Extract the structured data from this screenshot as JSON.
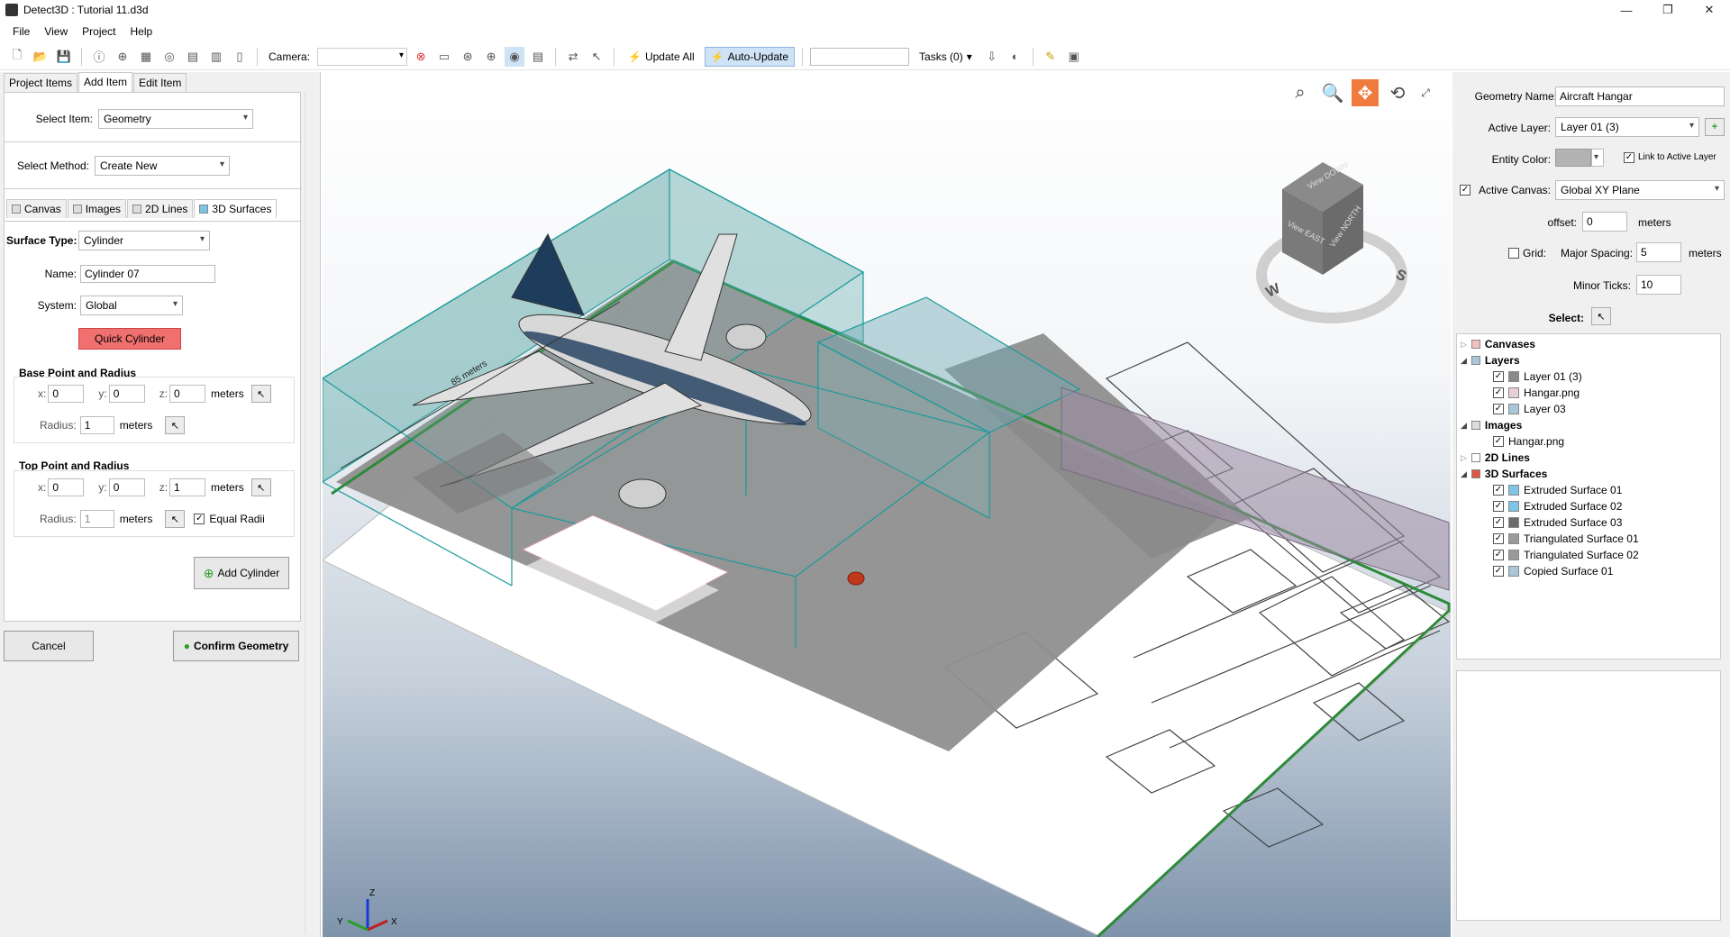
{
  "window": {
    "title": "Detect3D : Tutorial 11.d3d",
    "min": "—",
    "max": "❐",
    "close": "✕"
  },
  "menu": [
    "File",
    "View",
    "Project",
    "Help"
  ],
  "toolbar": {
    "camera_label": "Camera:",
    "update_all": "Update All",
    "auto_update": "Auto-Update",
    "tasks": "Tasks (0)"
  },
  "left": {
    "tabs": [
      "Project Items",
      "Add Item",
      "Edit Item"
    ],
    "select_item_label": "Select Item:",
    "select_item_value": "Geometry",
    "select_method_label": "Select Method:",
    "select_method_value": "Create New",
    "subtabs": [
      "Canvas",
      "Images",
      "2D Lines",
      "3D Surfaces"
    ],
    "surface_type_label": "Surface Type:",
    "surface_type_value": "Cylinder",
    "name_label": "Name:",
    "name_value": "Cylinder 07",
    "system_label": "System:",
    "system_value": "Global",
    "quick_cylinder": "Quick Cylinder",
    "base_title": "Base Point and Radius",
    "top_title": "Top Point and Radius",
    "x_label": "x:",
    "y_label": "y:",
    "z_label": "z:",
    "meters": "meters",
    "radius_label": "Radius:",
    "base": {
      "x": "0",
      "y": "0",
      "z": "0",
      "radius": "1"
    },
    "top": {
      "x": "0",
      "y": "0",
      "z": "1",
      "radius": "1"
    },
    "equal_radii": "Equal Radii",
    "add_cylinder": "Add Cylinder",
    "cancel": "Cancel",
    "confirm": "Confirm Geometry"
  },
  "viewport": {
    "cube_top": "View DOWN",
    "cube_left": "View EAST",
    "cube_right": "View NORTH",
    "compass_w": "W",
    "compass_s": "S",
    "dimension": "85 meters",
    "axis_x": "X",
    "axis_y": "Y",
    "axis_z": "Z"
  },
  "right": {
    "geometry_name_label": "Geometry Name:",
    "geometry_name_value": "Aircraft Hangar",
    "active_layer_label": "Active Layer:",
    "active_layer_value": "Layer 01 (3)",
    "entity_color_label": "Entity Color:",
    "link_layer": "Link to Active Layer",
    "active_canvas_label": "Active Canvas:",
    "active_canvas_value": "Global XY Plane",
    "offset_label": "offset:",
    "offset_value": "0",
    "meters": "meters",
    "grid_label": "Grid:",
    "major_spacing_label": "Major Spacing:",
    "major_spacing_value": "5",
    "minor_ticks_label": "Minor Ticks:",
    "minor_ticks_value": "10",
    "select_label": "Select:"
  },
  "tree": {
    "canvases": "Canvases",
    "layers": "Layers",
    "layer_items": [
      "Layer 01 (3)",
      "Hangar.png",
      "Layer 03"
    ],
    "layer_colors": [
      "#8a8a8a",
      "#e7cfd8",
      "#a9c7d8"
    ],
    "images": "Images",
    "image_items": [
      "Hangar.png"
    ],
    "lines2d": "2D Lines",
    "surfaces": "3D Surfaces",
    "surface_items": [
      "Extruded Surface 01",
      "Extruded Surface 02",
      "Extruded Surface 03",
      "Triangulated Surface 01",
      "Triangulated Surface 02",
      "Copied Surface 01"
    ],
    "surface_colors": [
      "#7ec3e8",
      "#7ec3e8",
      "#6b6b6b",
      "#9a9a9a",
      "#9a9a9a",
      "#a9c7d8"
    ]
  },
  "colors": {
    "accent": "#f07b3f",
    "quick": "#f07070",
    "teal": "#1a9a9a"
  }
}
